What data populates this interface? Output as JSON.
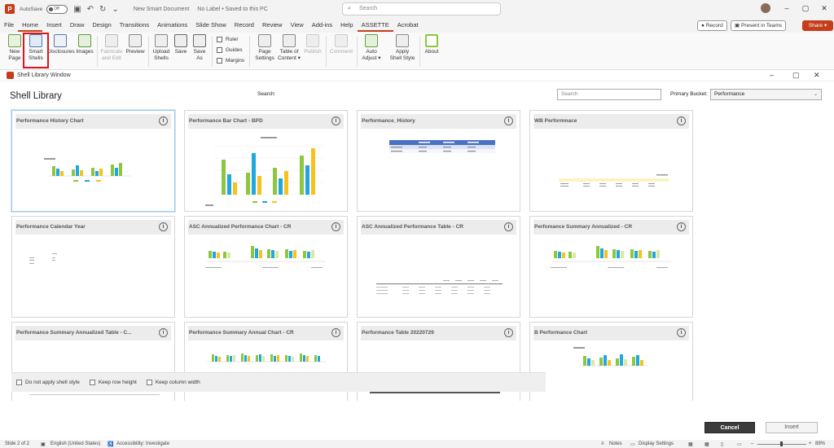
{
  "titlebar": {
    "app_letter": "P",
    "autosave_label": "AutoSave",
    "autosave_state": "Off",
    "doc_title": "New Smart Document",
    "label_status": "No Label • Saved to this PC",
    "search_placeholder": "Search"
  },
  "tabs": [
    "File",
    "Home",
    "Insert",
    "Draw",
    "Design",
    "Transitions",
    "Animations",
    "Slide Show",
    "Record",
    "Review",
    "View",
    "Add-ins",
    "Help",
    "ASSETTE",
    "Acrobat"
  ],
  "right_buttons": {
    "record": "Record",
    "present": "Present in Teams",
    "share": "Share"
  },
  "ribbon": {
    "new_page_1": "New",
    "new_page_2": "Page",
    "smart_shells_1": "Smart",
    "smart_shells_2": "Shells",
    "disclosures": "Disclosures",
    "images": "Images",
    "fabricate_1": "Fabricate",
    "fabricate_2": "and Edit",
    "preview": "Preview",
    "upload_1": "Upload",
    "upload_2": "Shells",
    "save": "Save",
    "save_as_1": "Save",
    "save_as_2": "As",
    "ruler": "Ruler",
    "guides": "Guides",
    "margins": "Margins",
    "page_settings_1": "Page",
    "page_settings_2": "Settings",
    "toc_1": "Table of",
    "toc_2": "Content",
    "publish": "Publish",
    "comment": "Comment",
    "auto_adjust_1": "Auto",
    "auto_adjust_2": "Adjust",
    "apply_style_1": "Apply",
    "apply_style_2": "Shell Style",
    "about": "About"
  },
  "dialog": {
    "window_title": "Shell Library Window",
    "heading": "Shell Library",
    "search_label": "Search:",
    "search_placeholder": "Search",
    "bucket_label": "Primary Bucket:",
    "bucket_value": "Performance",
    "cards": [
      "Performance History Chart",
      "Performance Bar Chart - BPD",
      "Performance_History",
      "WB Performnace",
      "Performance Calendar Year",
      "ASC Annualized Performance Chart - CR",
      "ASC Annualized Performance Table - CR",
      "Perfomance Summary Annualized - CR",
      "Performance Summary Annualized Table - C...",
      "Performance Summary Annual Chart - CR",
      "Performance Table 20220729",
      "B Performance Chart"
    ],
    "options": {
      "no_shell_style": "Do not apply shell style",
      "keep_row": "Keep row height",
      "keep_col": "Keep column width"
    },
    "cancel": "Cancel",
    "insert": "Insert"
  },
  "status": {
    "slide": "Slide 2 of 2",
    "language": "English (United States)",
    "accessibility": "Accessibility: Investigate",
    "notes": "Notes",
    "display": "Display Settings",
    "zoom": "89%"
  },
  "colors": {
    "accent": "#c43e1c",
    "green": "#8dc63f",
    "blue": "#1fa7df",
    "yellow": "#f7c21b",
    "highlight": "#d9141f"
  }
}
